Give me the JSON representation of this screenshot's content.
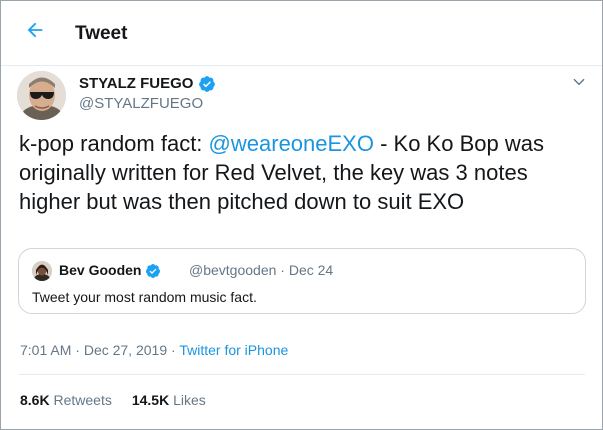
{
  "header": {
    "title": "Tweet",
    "back_icon": "arrow-left-icon"
  },
  "author": {
    "name": "STYALZ FUEGO",
    "handle": "@STYALZFUEGO",
    "verified": true
  },
  "tweet": {
    "text_before": "k-pop random fact: ",
    "mention": "@weareoneEXO",
    "text_after": " - Ko Ko Bop was originally written for Red Velvet, the key was 3 notes higher but was then pitched down to suit EXO"
  },
  "quoted_tweet": {
    "name": "Bev Gooden",
    "handle": "@bevtgooden",
    "separator": "·",
    "date": "Dec 24",
    "text": "Tweet your most random music fact.",
    "verified": true
  },
  "meta": {
    "time": "7:01 AM",
    "separator": "·",
    "date": "Dec 27, 2019",
    "source": "Twitter for iPhone"
  },
  "stats": {
    "retweets_count": "8.6K",
    "retweets_label": "Retweets",
    "likes_count": "14.5K",
    "likes_label": "Likes"
  },
  "colors": {
    "accent": "#1b95e0",
    "muted": "#657786",
    "text": "#14171a",
    "border": "#e6ecf0"
  }
}
